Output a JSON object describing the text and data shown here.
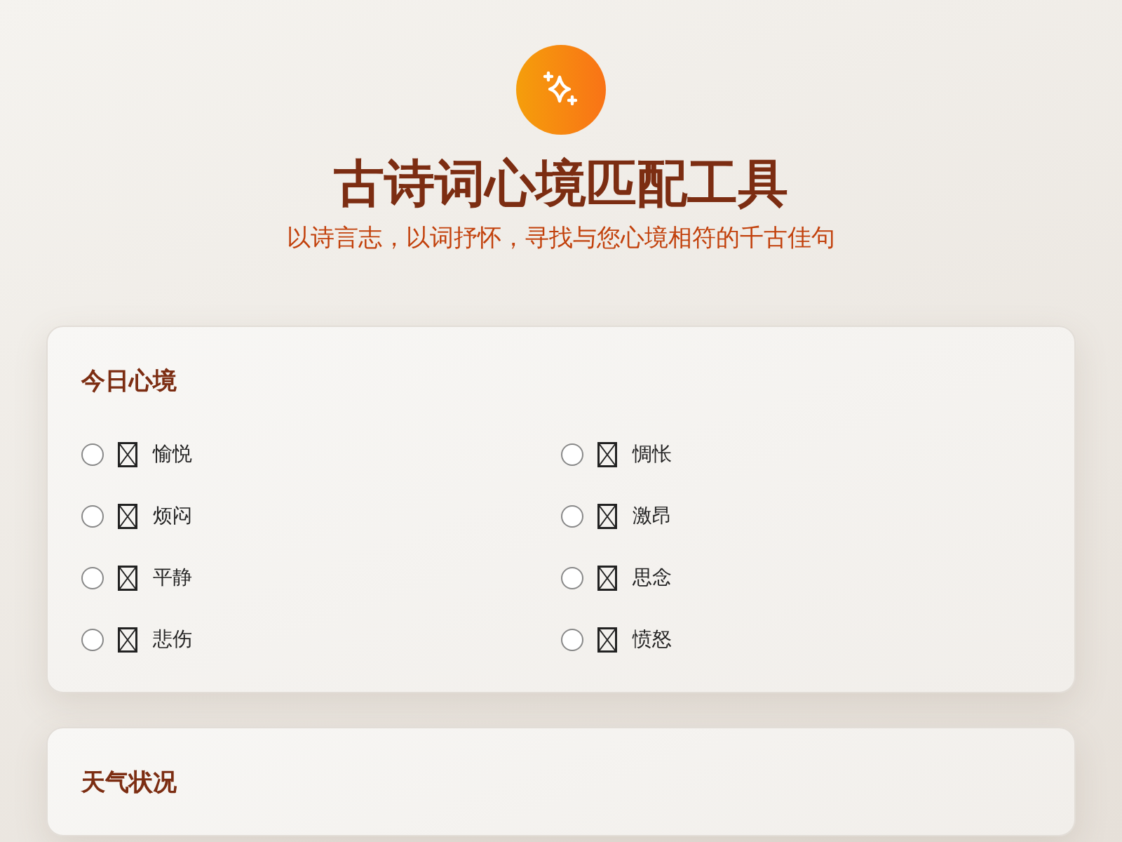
{
  "header": {
    "title": "古诗词心境匹配工具",
    "subtitle": "以诗言志，以词抒怀，寻找与您心境相符的千古佳句"
  },
  "sections": [
    {
      "title": "今日心境",
      "options": [
        {
          "label": "愉悦",
          "selected": false
        },
        {
          "label": "惆怅",
          "selected": false
        },
        {
          "label": "烦闷",
          "selected": false
        },
        {
          "label": "激昂",
          "selected": false
        },
        {
          "label": "平静",
          "selected": false
        },
        {
          "label": "思念",
          "selected": false
        },
        {
          "label": "悲伤",
          "selected": false
        },
        {
          "label": "愤怒",
          "selected": false
        }
      ]
    },
    {
      "title": "天气状况"
    }
  ]
}
